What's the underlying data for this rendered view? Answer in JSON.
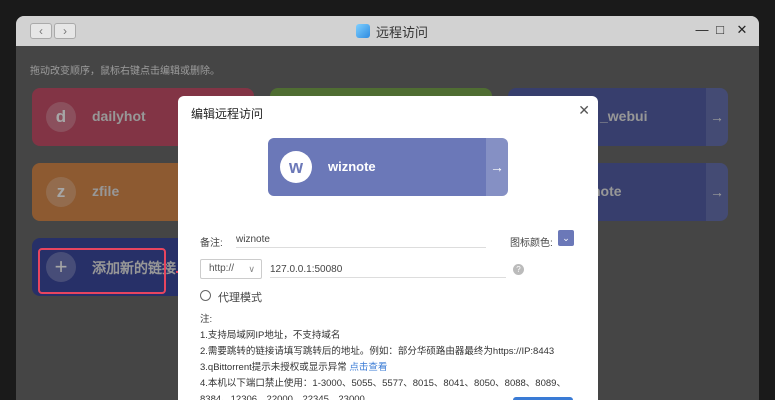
{
  "window": {
    "title": "远程访问"
  },
  "hint": "拖动改变顺序，鼠标右键点击编辑或删除。",
  "tiles": [
    {
      "letter": "d",
      "name": "dailyhot",
      "color": "#c8506a"
    },
    {
      "letter": "",
      "name": "",
      "color": "#7aa84e"
    },
    {
      "letter": "",
      "name": "_webui",
      "color": "#5560a8"
    },
    {
      "letter": "z",
      "name": "zfile",
      "color": "#d98a4c"
    },
    {
      "letter": "",
      "name": "",
      "color": "#7aa84e"
    },
    {
      "letter": "",
      "name": "note",
      "color": "#5560a8"
    }
  ],
  "add_tile": {
    "label": "添加新的链接",
    "icon": "plus-icon"
  },
  "dialog": {
    "title": "编辑远程访问",
    "preview": {
      "letter": "w",
      "name": "wiznote",
      "color": "#6b78b8"
    },
    "note_label": "备注:",
    "note_value": "wiznote",
    "icon_color_label": "图标颜色:",
    "protocol": "http://",
    "address": "127.0.0.1:50080",
    "proxy_label": "代理模式",
    "notes_title": "注:",
    "notes": [
      "1.支持局域网IP地址，不支持域名",
      "2.需要跳转的链接请填写跳转后的地址。例如：部分华硕路由器最终为https://IP:8443",
      "3.qBittorrent提示未授权或显示异常",
      "4.本机以下端口禁止使用：1-3000、5055、5577、8015、8041、8050、8088、8089、",
      "8384、12306、22000、22345、23000"
    ],
    "notes_link": "点击查看"
  }
}
